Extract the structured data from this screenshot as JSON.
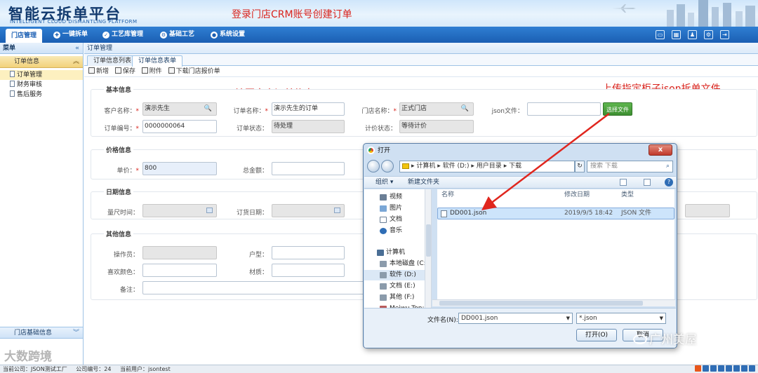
{
  "header": {
    "logo_main": "智能云拆单平台",
    "logo_sub": "INTELLIGENT CLOUD DISMANTLING PLATFORM",
    "annotation": "登录门店CRM账号创建订单"
  },
  "nav": {
    "items": [
      "门店管理",
      "一键拆单",
      "工艺库管理",
      "基础工艺",
      "系统设置"
    ],
    "tools": [
      "monitor-icon",
      "calendar-icon",
      "users-icon",
      "gear-icon",
      "logout-icon"
    ]
  },
  "sidebar": {
    "title": "菜单",
    "group": "订单信息",
    "items": [
      "订单管理",
      "财务审核",
      "售后服务"
    ],
    "footer": "门店基础信息"
  },
  "main": {
    "breadcrumb": "订单管理",
    "tabs": [
      "订单信息列表",
      "订单信息表单"
    ],
    "toolbar": [
      "新增",
      "保存",
      "附件",
      "下载门店报价单"
    ],
    "annotation_fill": "填写客户订单信息",
    "annotation_upload": "上传指定柜子json拆单文件"
  },
  "basic": {
    "title": "基本信息",
    "customer_label": "客户名称：",
    "customer_value": "演示先生",
    "order_name_label": "订单名称：",
    "order_name_value": "演示先生的订单",
    "store_label": "门店名称：",
    "store_value": "正式门店",
    "json_label": "json文件：",
    "choose_btn": "选择文件",
    "order_no_label": "订单编号：",
    "order_no_value": "0000000064",
    "status_label": "订单状态：",
    "status_value": "待处理",
    "price_status_label": "计价状态：",
    "price_status_value": "等待计价"
  },
  "price": {
    "title": "价格信息",
    "unit_label": "单价：",
    "unit_value": "800",
    "total_label": "总金额："
  },
  "date": {
    "title": "日期信息",
    "measure_label": "量尺时间：",
    "order_date_label": "订货日期："
  },
  "other": {
    "title": "其他信息",
    "operator_label": "操作员：",
    "house_label": "户型：",
    "color_label": "喜欢颜色：",
    "material_label": "材质：",
    "remark_label": "备注："
  },
  "dialog": {
    "title": "打开",
    "close": "x",
    "path": [
      "计算机",
      "软件 (D:)",
      "用户目录",
      "下载"
    ],
    "search_placeholder": "搜索 下载",
    "organize": "组织 ▾",
    "new_folder": "新建文件夹",
    "nav_items": [
      "视频",
      "图片",
      "文档",
      "音乐",
      "计算机",
      "本地磁盘 (C:",
      "软件 (D:)",
      "文档 (E:)",
      "其他 (F:)",
      "Meiwu-Ton:"
    ],
    "columns": [
      "名称",
      "修改日期",
      "类型"
    ],
    "file": {
      "name": "DD001.json",
      "date": "2019/9/5 18:42",
      "type": "JSON 文件"
    },
    "filename_label": "文件名(N):",
    "filename_value": "DD001.json",
    "filetype_value": "*.json",
    "open_btn": "打开(O)",
    "cancel_btn": "取消"
  },
  "statusbar": {
    "company": "当前公司：JSON测试工厂",
    "company_no": "公司编号：24",
    "user": "当前用户：jsontest"
  },
  "watermarks": {
    "left": "大数跨境",
    "right": "广州美屋"
  },
  "colors": {
    "nav_blue": "#1b5fb3",
    "annotation_red": "#d9231c",
    "choose_green": "#3d8f31"
  }
}
